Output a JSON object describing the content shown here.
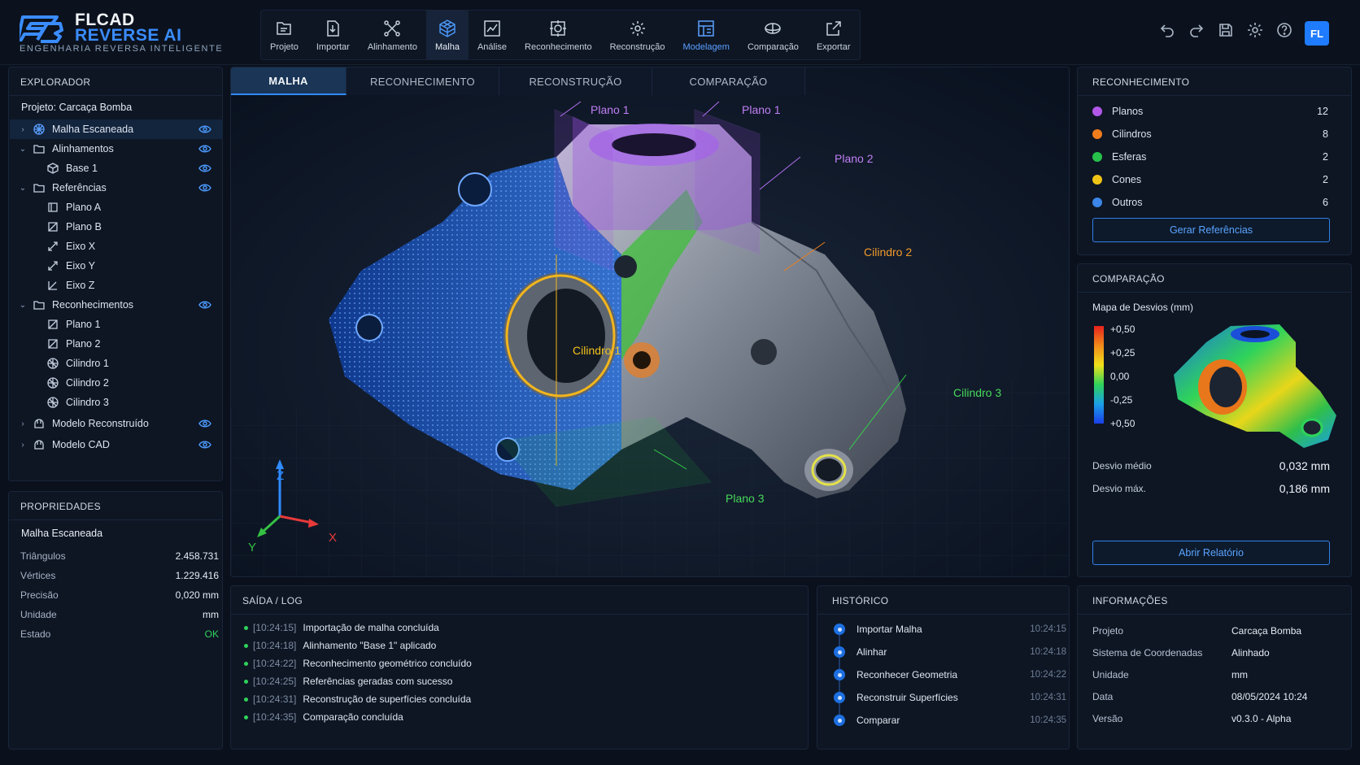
{
  "app": {
    "logo_line1": "FLCAD",
    "logo_line2": "REVERSE AI",
    "tagline": "ENGENHARIA REVERSA INTELIGENTE",
    "user_initials": "FL",
    "accent": "#1f7bff"
  },
  "toolbar": [
    {
      "label": "Projeto",
      "icon": "folder-icon"
    },
    {
      "label": "Importar",
      "icon": "import-icon"
    },
    {
      "label": "Alinhamento",
      "icon": "alignment-icon"
    },
    {
      "label": "Malha",
      "icon": "mesh-icon"
    },
    {
      "label": "Análise",
      "icon": "analysis-icon"
    },
    {
      "label": "Reconhecimento",
      "icon": "recognition-icon"
    },
    {
      "label": "Reconstrução",
      "icon": "reconstruction-icon"
    },
    {
      "label": "Modelagem",
      "icon": "modeling-icon"
    },
    {
      "label": "Comparação",
      "icon": "comparison-icon"
    },
    {
      "label": "Exportar",
      "icon": "export-icon"
    }
  ],
  "header_icons": [
    "undo-icon",
    "redo-icon",
    "save-icon",
    "settings-icon",
    "help-icon"
  ],
  "explorer": {
    "title": "EXPLORADOR",
    "project": "Projeto: Carcaça Bomba",
    "items": [
      {
        "label": "Malha Escaneada",
        "icon": "mesh-icon",
        "selected": true
      },
      {
        "label": "Alinhamentos",
        "icon": "folder-icon"
      },
      {
        "label": "Base 1",
        "icon": "base-icon"
      },
      {
        "label": "Referências",
        "icon": "folder-icon"
      },
      {
        "label": "Plano A",
        "icon": "plane-icon"
      },
      {
        "label": "Plano B",
        "icon": "plane-icon"
      },
      {
        "label": "Eixo X",
        "icon": "axis-icon"
      },
      {
        "label": "Eixo Y",
        "icon": "axis-icon"
      },
      {
        "label": "Eixo Z",
        "icon": "axis-icon"
      },
      {
        "label": "Reconhecimentos",
        "icon": "folder-icon"
      },
      {
        "label": "Plano 1",
        "icon": "plane-icon"
      },
      {
        "label": "Plano 2",
        "icon": "plane-icon"
      },
      {
        "label": "Cilindro 1",
        "icon": "cylinder-icon"
      },
      {
        "label": "Cilindro 2",
        "icon": "cylinder-icon"
      },
      {
        "label": "Cilindro 3",
        "icon": "cylinder-icon"
      },
      {
        "label": "Modelo Reconstruído",
        "icon": "model-icon"
      },
      {
        "label": "Modelo CAD",
        "icon": "model-icon"
      }
    ]
  },
  "properties": {
    "title": "PROPRIEDADES",
    "object": "Malha Escaneada",
    "rows": [
      {
        "key": "Triângulos",
        "value": "2.458.731"
      },
      {
        "key": "Vértices",
        "value": "1.229.416"
      },
      {
        "key": "Precisão",
        "value": "0,020 mm"
      },
      {
        "key": "Unidade",
        "value": "mm"
      },
      {
        "key": "Estado",
        "value": "OK"
      }
    ]
  },
  "viewport": {
    "tabs": [
      "MALHA",
      "RECONHECIMENTO",
      "RECONSTRUÇÃO",
      "COMPARAÇÃO"
    ],
    "annotations": {
      "plano1a": "Plano 1",
      "plano1b": "Plano 1",
      "plano2": "Plano 2",
      "cilindro2": "Cilindro 2",
      "cilindro1": "Cilindro 1",
      "cilindro3": "Cilindro 3",
      "plano3": "Plano 3"
    },
    "axes": {
      "x": "X",
      "y": "Y",
      "z": "Z"
    }
  },
  "recognition": {
    "title": "RECONHECIMENTO",
    "items": [
      {
        "label": "Planos",
        "count": "12",
        "color": "#b257e8"
      },
      {
        "label": "Cilindros",
        "count": "8",
        "color": "#f07d1c"
      },
      {
        "label": "Esferas",
        "count": "2",
        "color": "#26c04a"
      },
      {
        "label": "Cones",
        "count": "2",
        "color": "#f0c416"
      },
      {
        "label": "Outros",
        "count": "6",
        "color": "#3b86e8"
      }
    ],
    "button": "Gerar Referências"
  },
  "comparison": {
    "title": "COMPARAÇÃO",
    "map_title": "Mapa de Desvios (mm)",
    "scale": [
      "+0,50",
      "+0,25",
      "0,00",
      "-0,25",
      "+0,50"
    ],
    "mean_label": "Desvio médio",
    "mean_value": "0,032 mm",
    "max_label": "Desvio máx.",
    "max_value": "0,186 mm",
    "button": "Abrir Relatório"
  },
  "log": {
    "title": "SAÍDA / LOG",
    "entries": [
      {
        "time": "[10:24:15]",
        "msg": "Importação de malha concluída"
      },
      {
        "time": "[10:24:18]",
        "msg": "Alinhamento \"Base 1\" aplicado"
      },
      {
        "time": "[10:24:22]",
        "msg": "Reconhecimento geométrico concluído"
      },
      {
        "time": "[10:24:25]",
        "msg": "Referências geradas com sucesso"
      },
      {
        "time": "[10:24:31]",
        "msg": "Reconstrução de superfícies concluída"
      },
      {
        "time": "[10:24:35]",
        "msg": "Comparação concluída"
      }
    ]
  },
  "history": {
    "title": "HISTÓRICO",
    "entries": [
      {
        "label": "Importar Malha",
        "time": "10:24:15"
      },
      {
        "label": "Alinhar",
        "time": "10:24:18"
      },
      {
        "label": "Reconhecer Geometria",
        "time": "10:24:22"
      },
      {
        "label": "Reconstruir Superfícies",
        "time": "10:24:31"
      },
      {
        "label": "Comparar",
        "time": "10:24:35"
      }
    ]
  },
  "info": {
    "title": "INFORMAÇÕES",
    "rows": [
      {
        "key": "Projeto",
        "value": "Carcaça Bomba"
      },
      {
        "key": "Sistema de Coordenadas",
        "value": "Alinhado"
      },
      {
        "key": "Unidade",
        "value": "mm"
      },
      {
        "key": "Data",
        "value": "08/05/2024 10:24"
      },
      {
        "key": "Versão",
        "value": "v0.3.0 - Alpha"
      }
    ]
  }
}
